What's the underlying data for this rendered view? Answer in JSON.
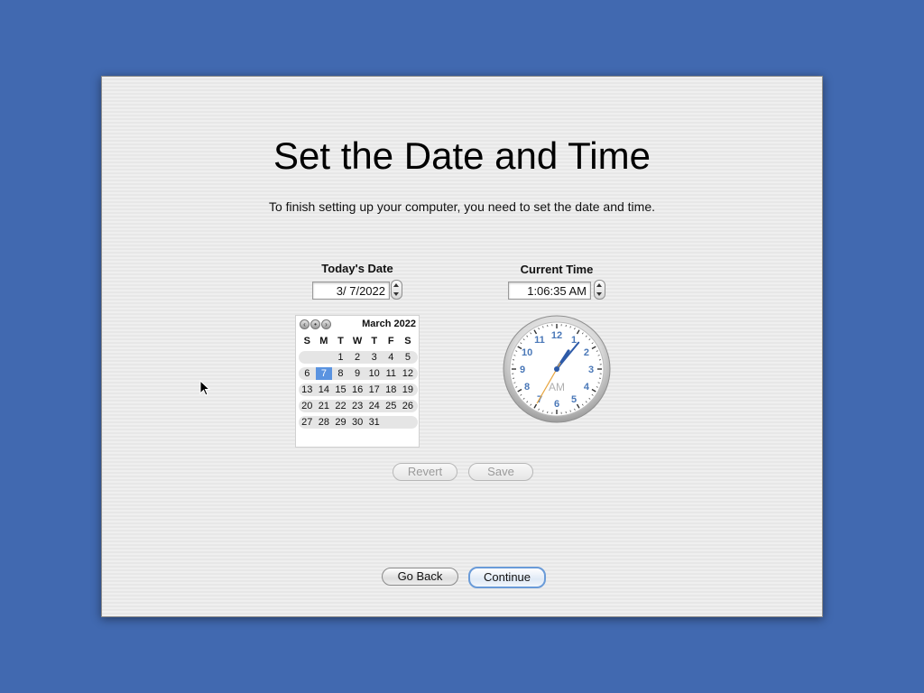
{
  "title": "Set the Date and Time",
  "subtitle": "To finish setting up your computer, you need to set the date and time.",
  "date_section": {
    "label": "Today's Date",
    "value": "3/  7/2022"
  },
  "time_section": {
    "label": "Current Time",
    "value": "1:06:35 AM"
  },
  "calendar": {
    "month_label": "March 2022",
    "nav_icons": [
      "arrow-left-icon",
      "today-dot-icon",
      "arrow-right-icon"
    ],
    "weekdays": [
      "S",
      "M",
      "T",
      "W",
      "T",
      "F",
      "S"
    ],
    "weeks": [
      [
        "",
        "",
        "1",
        "2",
        "3",
        "4",
        "5"
      ],
      [
        "6",
        "7",
        "8",
        "9",
        "10",
        "11",
        "12"
      ],
      [
        "13",
        "14",
        "15",
        "16",
        "17",
        "18",
        "19"
      ],
      [
        "20",
        "21",
        "22",
        "23",
        "24",
        "25",
        "26"
      ],
      [
        "27",
        "28",
        "29",
        "30",
        "31",
        "",
        ""
      ]
    ],
    "selected_day": "7"
  },
  "clock": {
    "numerals": [
      "12",
      "1",
      "2",
      "3",
      "4",
      "5",
      "6",
      "7",
      "8",
      "9",
      "10",
      "11"
    ],
    "period_label": "AM",
    "time": {
      "hours": 1,
      "minutes": 6,
      "seconds": 35
    }
  },
  "buttons": {
    "revert": "Revert",
    "save": "Save",
    "go_back": "Go Back",
    "continue": "Continue"
  },
  "colors": {
    "desktop": "#4169b0",
    "selection": "#5a93e0",
    "clock_numerals": "#4a78b8",
    "second_hand": "#e8a640",
    "hour_minute_hands": "#2d5aa8"
  }
}
